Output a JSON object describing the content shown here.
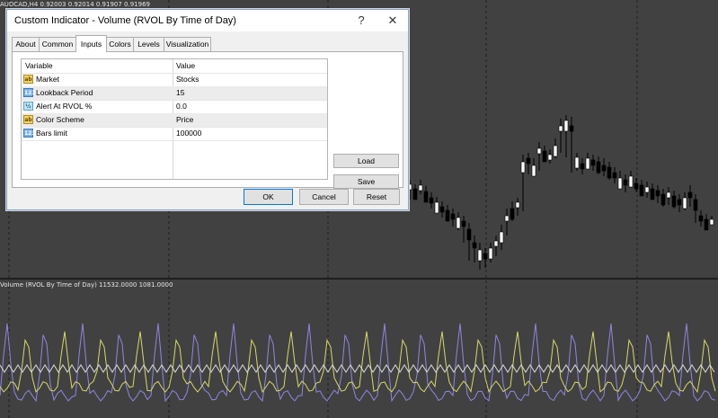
{
  "chart": {
    "symbol_header": "AUDCAD,H4  0.92003 0.92014 0.91907 0.91969",
    "indicator_header": "Volume (RVOL By Time of Day) 11532.0000 1081.0000"
  },
  "dialog": {
    "title": "Custom Indicator - Volume (RVOL By Time of Day)",
    "help_symbol": "?",
    "close_symbol": "✕",
    "tabs": [
      {
        "label": "About"
      },
      {
        "label": "Common"
      },
      {
        "label": "Inputs"
      },
      {
        "label": "Colors"
      },
      {
        "label": "Levels"
      },
      {
        "label": "Visualization"
      }
    ],
    "active_tab": "Inputs",
    "grid": {
      "col_variable": "Variable",
      "col_value": "Value",
      "rows": [
        {
          "icon": "ab",
          "icon_text": "ab",
          "variable": "Market",
          "value": "Stocks"
        },
        {
          "icon": "123",
          "icon_text": "123",
          "variable": "Lookback Period",
          "value": "15"
        },
        {
          "icon": "double",
          "icon_text": "½",
          "variable": "Alert At RVOL %",
          "value": "0.0"
        },
        {
          "icon": "ab",
          "icon_text": "ab",
          "variable": "Color Scheme",
          "value": "Price"
        },
        {
          "icon": "123",
          "icon_text": "123",
          "variable": "Bars limit",
          "value": "100000"
        }
      ]
    },
    "buttons": {
      "load": "Load",
      "save": "Save",
      "ok": "OK",
      "cancel": "Cancel",
      "reset": "Reset"
    }
  },
  "colors": {
    "chart_bg": "#414141",
    "candle_bull": "#ffffff",
    "candle_bear": "#000000",
    "volume_yellow": "#d8d86a",
    "volume_blue": "#8f87e0",
    "baseline": "#d8d8d8"
  }
}
